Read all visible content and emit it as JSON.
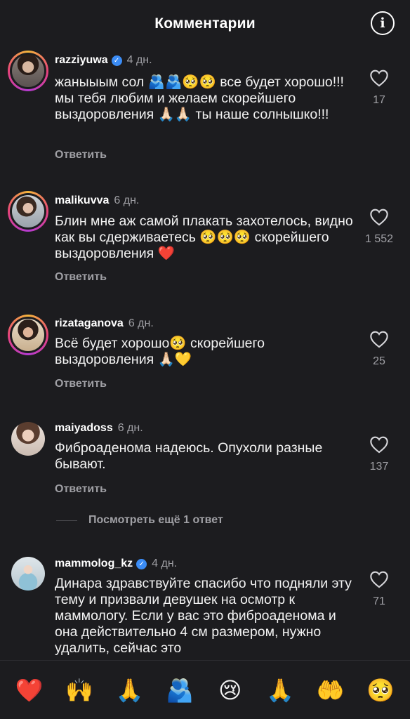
{
  "header": {
    "title": "Комментарии",
    "info_icon": "info-icon"
  },
  "comments": [
    {
      "username": "razziyuwa",
      "verified": true,
      "time": "4 дн.",
      "text": "жаныыым сол 🫂🫂🥺🥺 все будет хорошо!!! мы тебя любим и желаем скорейшего выздоровления 🙏🏻🙏🏻 ты наше солнышко!!!",
      "reply_label": "Ответить",
      "likes": "17"
    },
    {
      "username": "malikuvva",
      "verified": false,
      "time": "6 дн.",
      "text": "Блин мне аж самой плакать захотелось, видно как вы сдерживаетесь 🥺🥺🥺 скорейшего выздоровления ❤️",
      "reply_label": "Ответить",
      "likes": "1 552"
    },
    {
      "username": "rizataganova",
      "verified": false,
      "time": "6 дн.",
      "text": "Всё будет хорошо🥺 скорейшего выздоровления 🙏🏻💛",
      "reply_label": "Ответить",
      "likes": "25"
    },
    {
      "username": "maiyadoss",
      "verified": false,
      "time": "6 дн.",
      "text": "Фиброаденома надеюсь. Опухоли разные бывают.",
      "reply_label": "Ответить",
      "likes": "137"
    },
    {
      "username": "mammolog_kz",
      "verified": true,
      "time": "4 дн.",
      "text": "Динара здравствуйте спасибо что подняли эту тему и призвали девушек на осмотр к маммологу. Если у вас это фиброаденома и она действительно 4 см размером, нужно удалить, сейчас это",
      "reply_label": "",
      "likes": "71"
    }
  ],
  "more_replies_label": "Посмотреть ещё 1 ответ",
  "emoji_bar": [
    "❤️",
    "🙌",
    "🙏",
    "🫂",
    "😢",
    "🙏",
    "🤲",
    "🥺"
  ],
  "colors": {
    "background": "#1c1c1f",
    "secondary_text": "#a0a0a5",
    "verified": "#3b8cf5"
  }
}
